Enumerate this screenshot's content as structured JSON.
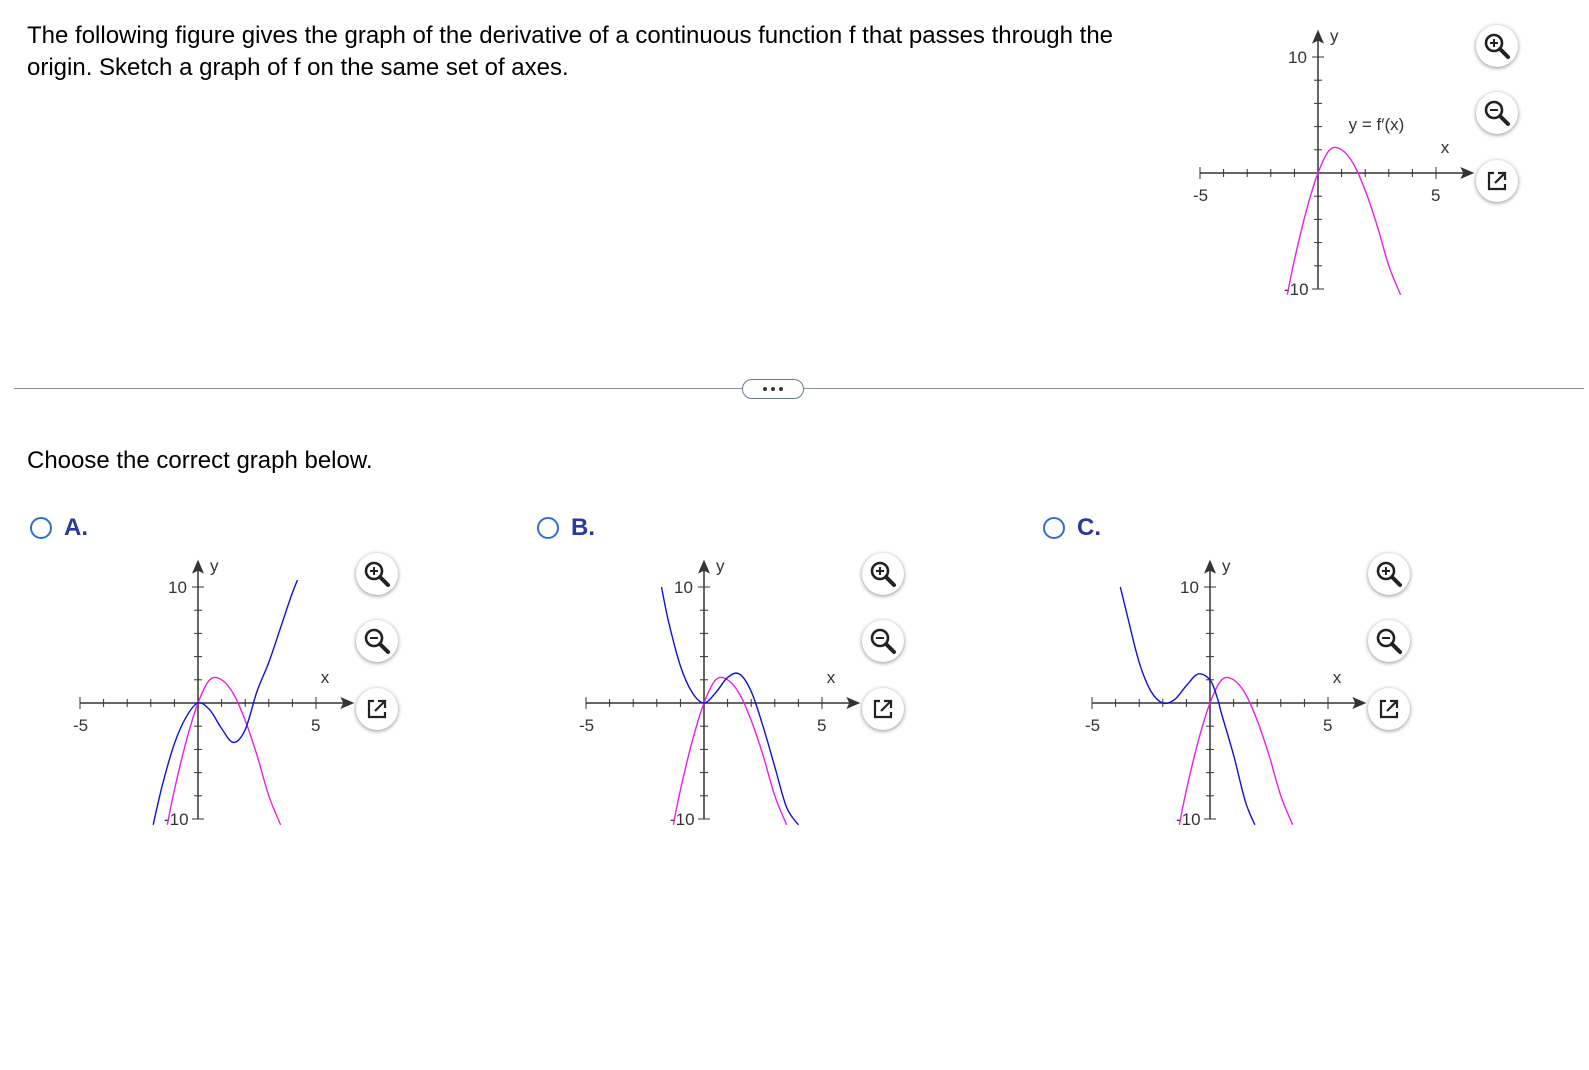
{
  "question_text": "The following figure gives the graph of the derivative of a continuous function f that passes through the origin. Sketch a graph of f on the same set of axes.",
  "instruction": "Choose the correct graph below.",
  "colors": {
    "fprime": "#e81ee8",
    "f": "#1010d8",
    "axis": "#333333",
    "accent": "#2a3a9a",
    "radio": "#2f6fd1"
  },
  "main_graph": {
    "x_tick_min": "-5",
    "x_tick_max": "5",
    "y_tick_max": "10",
    "y_tick_min": "-10",
    "x_label": "x",
    "y_label": "y",
    "curve_label": "y = f′(x)"
  },
  "options": [
    {
      "letter": "A.",
      "x_tick_min": "-5",
      "x_tick_max": "5",
      "y_tick_max": "10",
      "y_tick_min": "-10",
      "x_label": "x",
      "y_label": "y"
    },
    {
      "letter": "B.",
      "x_tick_min": "-5",
      "x_tick_max": "5",
      "y_tick_max": "10",
      "y_tick_min": "-10",
      "x_label": "x",
      "y_label": "y"
    },
    {
      "letter": "C.",
      "x_tick_min": "-5",
      "x_tick_max": "5",
      "y_tick_max": "10",
      "y_tick_min": "-10",
      "x_label": "x",
      "y_label": "y"
    }
  ],
  "icons": {
    "zoom_in": "zoom-in-icon",
    "zoom_out": "zoom-out-icon",
    "popout": "popout-icon",
    "more": "ellipsis-icon"
  },
  "chart_data": [
    {
      "type": "line",
      "x_range": [
        -5,
        5
      ],
      "y_range": [
        -10,
        10
      ],
      "series": [
        {
          "name": "y = f′(x)",
          "role": "fprime",
          "x": [
            -1.3,
            -1,
            -0.5,
            0,
            0.5,
            1,
            1.5,
            2,
            2.5,
            3,
            3.5
          ],
          "y": [
            -10.5,
            -7.5,
            -3.3,
            0,
            2.0,
            2.0,
            0.8,
            -1.5,
            -4.5,
            -8.0,
            -10.5
          ]
        }
      ]
    },
    {
      "type": "line",
      "x_range": [
        -5,
        5
      ],
      "y_range": [
        -10,
        10
      ],
      "series": [
        {
          "role": "fprime",
          "x": [
            -1.3,
            -1,
            -0.5,
            0,
            0.5,
            1,
            1.5,
            2,
            2.5,
            3,
            3.5
          ],
          "y": [
            -10.5,
            -7.5,
            -3.3,
            0,
            2.0,
            2.0,
            0.8,
            -1.5,
            -4.5,
            -8.0,
            -10.5
          ]
        },
        {
          "role": "f",
          "x": [
            -1.9,
            -1.5,
            -1,
            -0.5,
            0,
            0.5,
            1,
            1.5,
            2,
            2.5,
            3,
            3.5,
            4,
            4.4
          ],
          "y": [
            -10.5,
            -7.0,
            -3.5,
            -1.2,
            0,
            -0.6,
            -2.2,
            -3.4,
            -2.3,
            1.0,
            3.5,
            6.5,
            9.5,
            11.5
          ]
        }
      ]
    },
    {
      "type": "line",
      "x_range": [
        -5,
        5
      ],
      "y_range": [
        -10,
        10
      ],
      "series": [
        {
          "role": "fprime",
          "x": [
            -1.3,
            -1,
            -0.5,
            0,
            0.5,
            1,
            1.5,
            2,
            2.5,
            3,
            3.5
          ],
          "y": [
            -10.5,
            -7.5,
            -3.3,
            0,
            2.0,
            2.0,
            0.8,
            -1.5,
            -4.5,
            -8.0,
            -10.5
          ]
        },
        {
          "role": "f",
          "x": [
            -1.8,
            -1.5,
            -1,
            -0.5,
            0,
            0.5,
            1,
            1.5,
            2,
            2.5,
            3,
            3.5,
            4
          ],
          "y": [
            10,
            7.0,
            3.2,
            0.9,
            0,
            0.9,
            2.2,
            2.5,
            1.0,
            -2.0,
            -5.5,
            -9.0,
            -10.5
          ]
        }
      ]
    },
    {
      "type": "line",
      "x_range": [
        -5,
        5
      ],
      "y_range": [
        -10,
        10
      ],
      "series": [
        {
          "role": "fprime",
          "x": [
            -1.3,
            -1,
            -0.5,
            0,
            0.5,
            1,
            1.5,
            2,
            2.5,
            3,
            3.5
          ],
          "y": [
            -10.5,
            -7.5,
            -3.3,
            0,
            2.0,
            2.0,
            0.8,
            -1.5,
            -4.5,
            -8.0,
            -10.5
          ]
        },
        {
          "role": "f",
          "x": [
            -3.8,
            -3.5,
            -3,
            -2.5,
            -2,
            -1.5,
            -1,
            -0.5,
            0,
            0.3,
            0.5,
            1,
            1.5,
            1.9
          ],
          "y": [
            10,
            7.5,
            3.5,
            1.0,
            0,
            0.3,
            1.5,
            2.5,
            2.0,
            0.5,
            -1.0,
            -4.5,
            -8.5,
            -10.5
          ]
        }
      ]
    }
  ]
}
